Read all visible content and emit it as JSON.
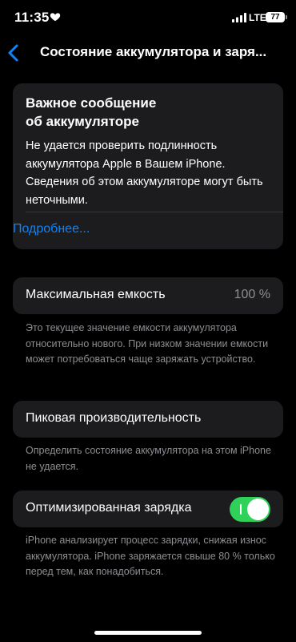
{
  "status_bar": {
    "time": "11:35",
    "network": "LTE",
    "battery_level": "77"
  },
  "nav": {
    "title": "Состояние аккумулятора и заря..."
  },
  "alert": {
    "title_line1": "Важное сообщение",
    "title_line2": "об аккумуляторе",
    "body": "Не удается проверить подлинность аккумулятора Apple в Вашем iPhone. Сведения об этом аккумуляторе могут быть неточными.",
    "link": "Подробнее..."
  },
  "max_capacity": {
    "label": "Максимальная емкость",
    "value": "100 %",
    "footnote": "Это текущее значение емкости аккумулятора относительно нового. При низком значении емкости может потребоваться чаще заряжать устройство."
  },
  "peak_performance": {
    "label": "Пиковая производительность",
    "footnote": "Определить состояние аккумулятора на этом iPhone не удается."
  },
  "optimized_charging": {
    "label": "Оптимизированная зарядка",
    "enabled": true,
    "footnote": "iPhone анализирует процесс зарядки, снижая износ аккумулятора. iPhone заряжается свыше 80 % только перед тем, как понадобиться."
  },
  "colors": {
    "accent": "#0a84ff",
    "toggle_on": "#30d158",
    "card_bg": "#1c1c1e",
    "secondary_text": "#8e8e93"
  }
}
